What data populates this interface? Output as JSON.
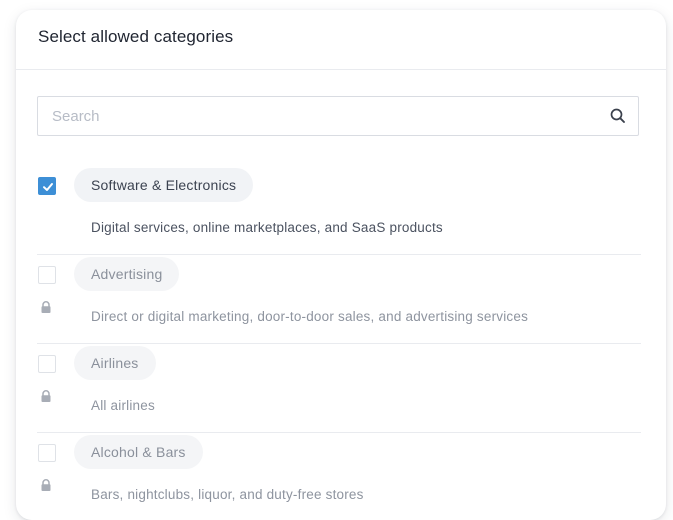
{
  "dialog": {
    "title": "Select allowed categories"
  },
  "search": {
    "placeholder": "Search",
    "value": "",
    "icon": "search-icon"
  },
  "categories": [
    {
      "label": "Software & Electronics",
      "description": "Digital services, online marketplaces, and SaaS products",
      "checked": true,
      "locked": false
    },
    {
      "label": "Advertising",
      "description": "Direct or digital marketing, door-to-door sales, and advertising services",
      "checked": false,
      "locked": true
    },
    {
      "label": "Airlines",
      "description": "All airlines",
      "checked": false,
      "locked": true
    },
    {
      "label": "Alcohol & Bars",
      "description": "Bars, nightclubs, liquor, and duty-free stores",
      "checked": false,
      "locked": true
    }
  ],
  "colors": {
    "accent": "#3d8fd6",
    "pill_background": "#f1f3f6",
    "divider": "#e9ebef"
  }
}
